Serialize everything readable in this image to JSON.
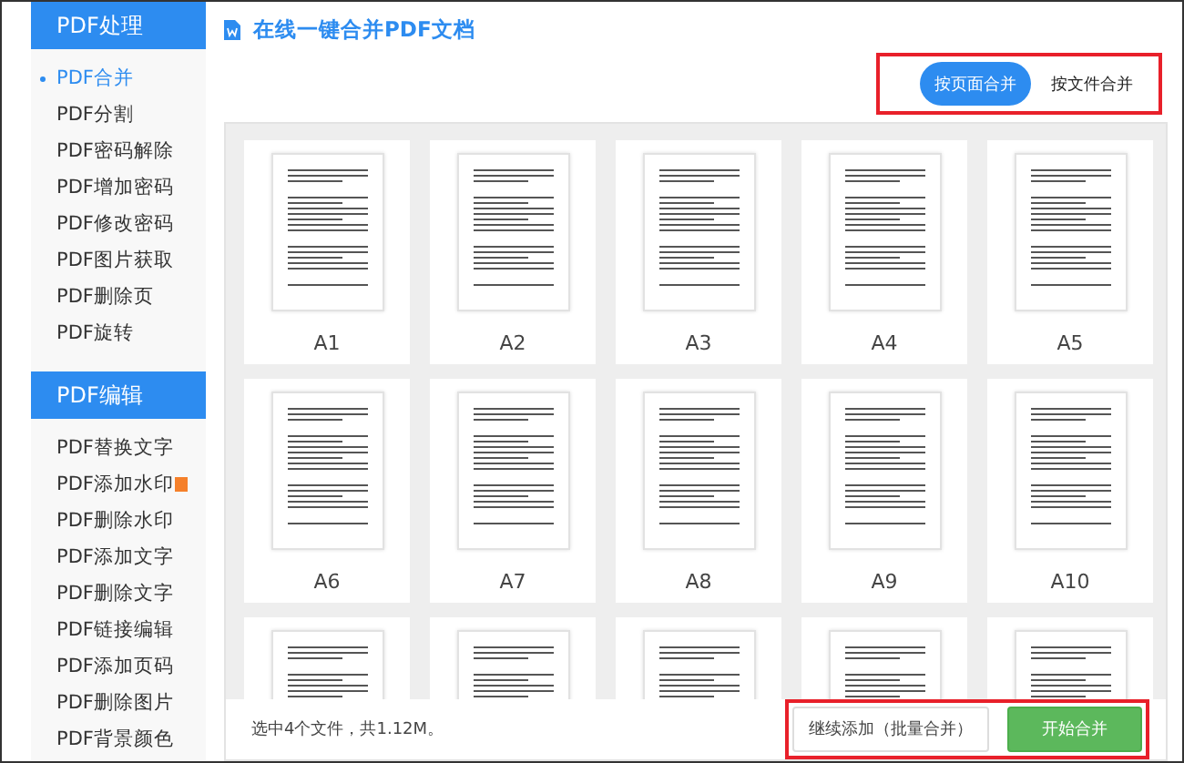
{
  "sidebar": {
    "sections": [
      {
        "title": "PDF处理",
        "items": [
          {
            "label": "PDF合并",
            "selected": true
          },
          {
            "label": "PDF分割",
            "selected": false
          },
          {
            "label": "PDF密码解除",
            "selected": false
          },
          {
            "label": "PDF增加密码",
            "selected": false
          },
          {
            "label": "PDF修改密码",
            "selected": false
          },
          {
            "label": "PDF图片获取",
            "selected": false
          },
          {
            "label": "PDF删除页",
            "selected": false
          },
          {
            "label": "PDF旋转",
            "selected": false
          }
        ]
      },
      {
        "title": "PDF编辑",
        "items": [
          {
            "label": "PDF替换文字",
            "selected": false
          },
          {
            "label": "PDF添加水印",
            "selected": false,
            "badge": true
          },
          {
            "label": "PDF删除水印",
            "selected": false
          },
          {
            "label": "PDF添加文字",
            "selected": false
          },
          {
            "label": "PDF删除文字",
            "selected": false
          },
          {
            "label": "PDF链接编辑",
            "selected": false
          },
          {
            "label": "PDF添加页码",
            "selected": false
          },
          {
            "label": "PDF删除图片",
            "selected": false
          },
          {
            "label": "PDF背景颜色",
            "selected": false
          }
        ]
      }
    ]
  },
  "header": {
    "title": "在线一键合并PDF文档"
  },
  "mode_toggle": [
    {
      "label": "按页面合并",
      "selected": true
    },
    {
      "label": "按文件合并",
      "selected": false
    }
  ],
  "pages": [
    {
      "kind": "full",
      "label": "A1"
    },
    {
      "kind": "full",
      "label": "A2"
    },
    {
      "kind": "full",
      "label": "A3"
    },
    {
      "kind": "full",
      "label": "A4"
    },
    {
      "kind": "full",
      "label": "A5"
    },
    {
      "kind": "full",
      "label": "A6"
    },
    {
      "kind": "full",
      "label": "A7"
    },
    {
      "kind": "full",
      "label": "A8"
    },
    {
      "kind": "full",
      "label": "A9"
    },
    {
      "kind": "full",
      "label": "A10"
    },
    {
      "kind": "partial"
    },
    {
      "kind": "partial"
    },
    {
      "kind": "partial"
    },
    {
      "kind": "partial"
    },
    {
      "kind": "partial"
    }
  ],
  "footer": {
    "status": "选中4个文件，共1.12M。",
    "buttons": [
      {
        "label": "继续添加（批量合并）",
        "kind": "secondary"
      },
      {
        "label": "开始合并",
        "kind": "primary"
      }
    ]
  }
}
